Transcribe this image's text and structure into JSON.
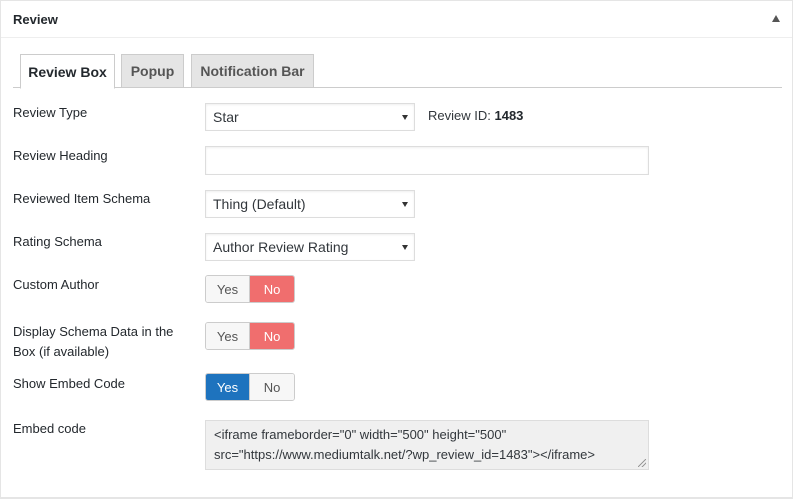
{
  "panel": {
    "title": "Review"
  },
  "tabs": [
    {
      "label": "Review Box",
      "active": true
    },
    {
      "label": "Popup",
      "active": false
    },
    {
      "label": "Notification Bar",
      "active": false
    }
  ],
  "fields": {
    "review_type": {
      "label": "Review Type",
      "value": "Star"
    },
    "review_id": {
      "label": "Review ID:",
      "value": "1483"
    },
    "review_heading": {
      "label": "Review Heading",
      "value": ""
    },
    "item_schema": {
      "label": "Reviewed Item Schema",
      "value": "Thing (Default)"
    },
    "rating_schema": {
      "label": "Rating Schema",
      "value": "Author Review Rating"
    },
    "custom_author": {
      "label": "Custom Author",
      "yes": "Yes",
      "no": "No",
      "selected": "No"
    },
    "display_schema": {
      "label_line1": "Display Schema Data in the",
      "label_line2": "Box (if available)",
      "yes": "Yes",
      "no": "No",
      "selected": "No"
    },
    "show_embed": {
      "label": "Show Embed Code",
      "yes": "Yes",
      "no": "No",
      "selected": "Yes"
    },
    "embed_code": {
      "label": "Embed code",
      "line1": "<iframe frameborder=\"0\" width=\"500\" height=\"500\"",
      "line2": "src=\"https://www.mediumtalk.net/?wp_review_id=1483\"></iframe>"
    }
  },
  "colors": {
    "switch_no_active": "#f06e6e",
    "switch_yes_active": "#1e73be"
  }
}
